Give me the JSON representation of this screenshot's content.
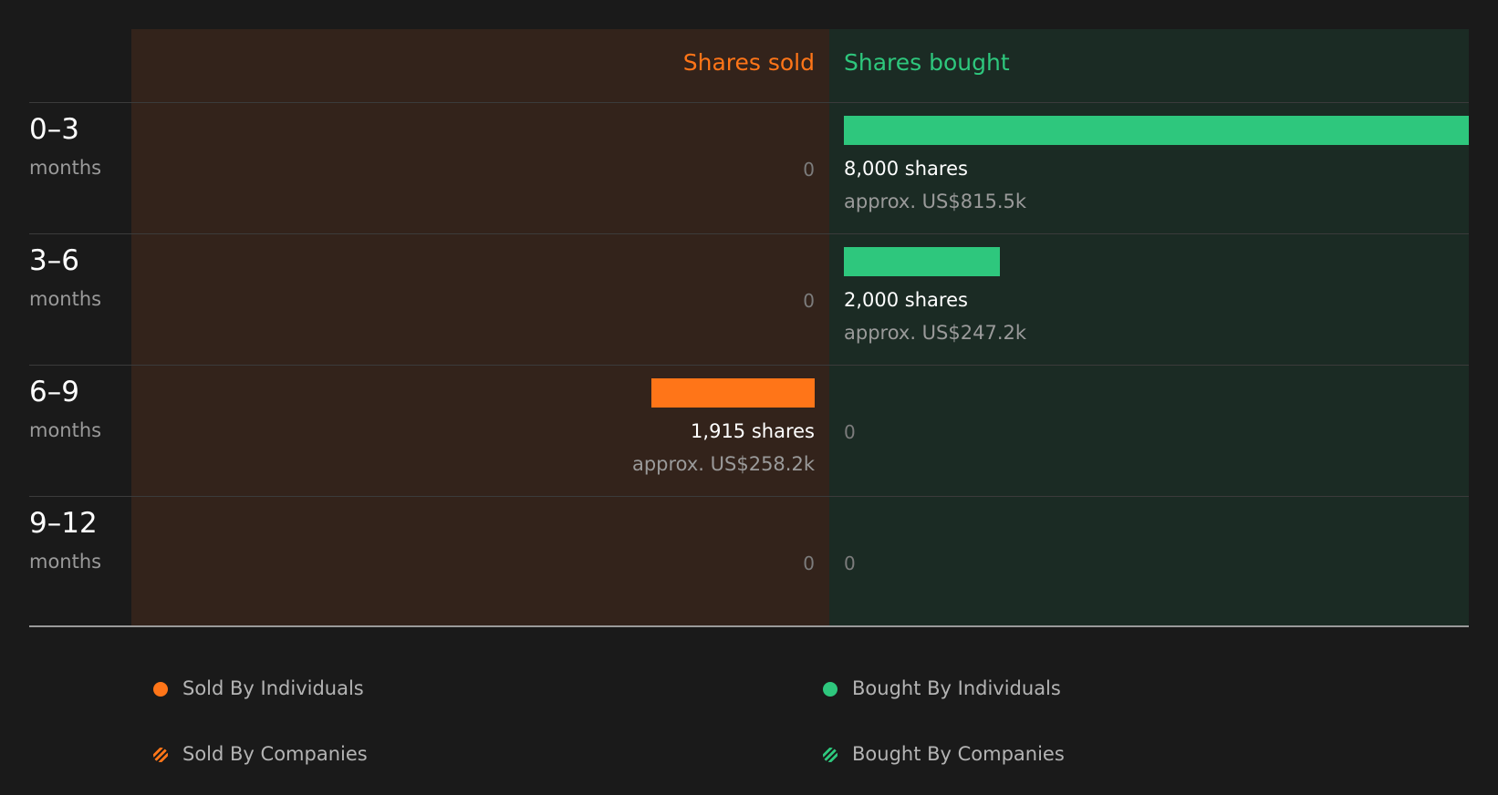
{
  "colors": {
    "sold": "#ff7518",
    "bought": "#2ec77d",
    "sold_panel": "#33231b",
    "bought_panel": "#1b2b24"
  },
  "chart_data": {
    "type": "bar",
    "orientation": "horizontal-diverging",
    "headers": {
      "sold": "Shares sold",
      "bought": "Shares bought"
    },
    "categories": [
      {
        "range": "0–3",
        "unit": "months"
      },
      {
        "range": "3–6",
        "unit": "months"
      },
      {
        "range": "6–9",
        "unit": "months"
      },
      {
        "range": "9–12",
        "unit": "months"
      }
    ],
    "series": [
      {
        "name": "Shares sold",
        "values": [
          0,
          0,
          1915,
          0
        ],
        "labels": [
          "0",
          "0",
          "1,915 shares",
          "0"
        ],
        "approx": [
          "",
          "",
          "approx. US$258.2k",
          ""
        ]
      },
      {
        "name": "Shares bought",
        "values": [
          8000,
          2000,
          0,
          0
        ],
        "labels": [
          "8,000 shares",
          "2,000 shares",
          "0",
          "0"
        ],
        "approx": [
          "approx. US$815.5k",
          "approx. US$247.2k",
          "",
          ""
        ]
      }
    ],
    "xlim": [
      0,
      8000
    ],
    "legend": {
      "placement": "bottom",
      "items": [
        {
          "label": "Sold By Individuals",
          "pattern": "solid",
          "side": "sold"
        },
        {
          "label": "Bought By Individuals",
          "pattern": "solid",
          "side": "bought"
        },
        {
          "label": "Sold By Companies",
          "pattern": "hatched",
          "side": "sold"
        },
        {
          "label": "Bought By Companies",
          "pattern": "hatched",
          "side": "bought"
        }
      ]
    }
  }
}
